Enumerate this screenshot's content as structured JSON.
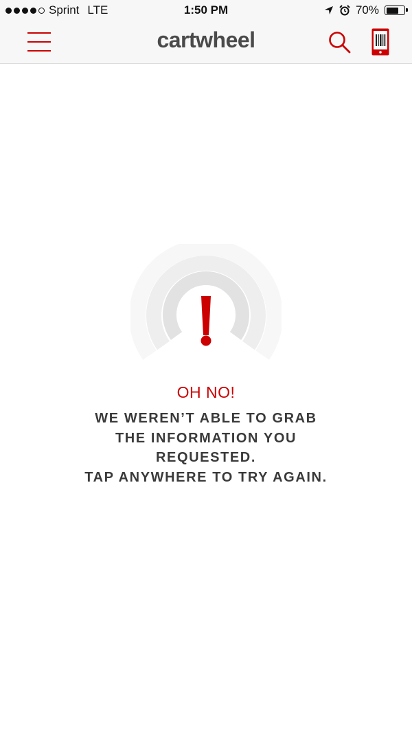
{
  "status_bar": {
    "carrier": "Sprint",
    "network": "LTE",
    "time": "1:50 PM",
    "battery_percent": "70%",
    "battery_level": 0.7,
    "signal_bars_filled": 4,
    "signal_bars_total": 5,
    "icons": [
      "location-arrow-icon",
      "alarm-icon",
      "battery-icon"
    ]
  },
  "nav": {
    "title": "cartwheel",
    "icons": [
      "hamburger-menu-icon",
      "search-icon",
      "barcode-wallet-icon"
    ]
  },
  "error": {
    "heading": "OH NO!",
    "lines": [
      "WE WEREN’T ABLE TO GRAB",
      "THE INFORMATION YOU",
      "REQUESTED.",
      "TAP ANYWHERE TO TRY AGAIN."
    ],
    "icon": "exclamation-signal-icon"
  },
  "colors": {
    "accent": "#cc0000",
    "title_text": "#4a4a4a",
    "body_text": "#3a3a3a",
    "bar_background": "#f7f7f7"
  }
}
